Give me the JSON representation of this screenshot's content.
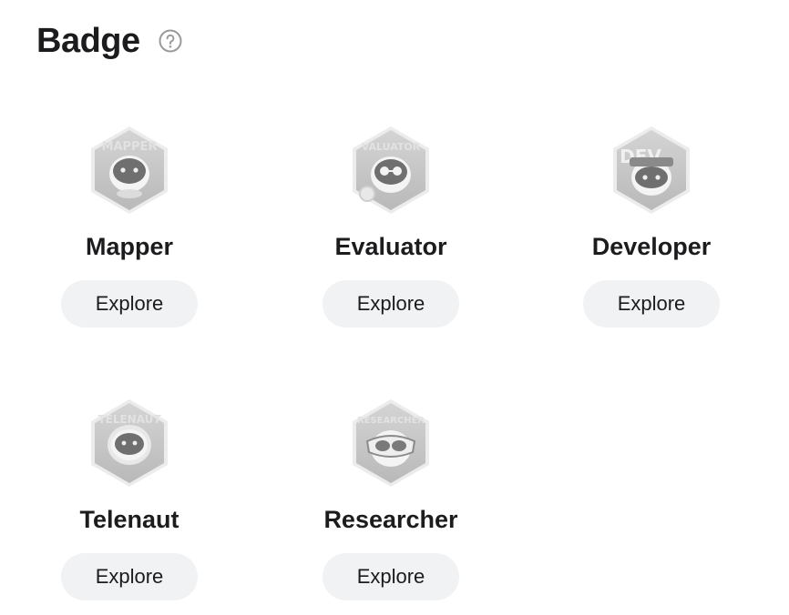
{
  "header": {
    "title": "Badge",
    "help_icon": "question-circle-icon"
  },
  "badges": [
    {
      "name": "Mapper",
      "button": "Explore",
      "icon": "mapper-badge-icon"
    },
    {
      "name": "Evaluator",
      "button": "Explore",
      "icon": "evaluator-badge-icon"
    },
    {
      "name": "Developer",
      "button": "Explore",
      "icon": "developer-badge-icon"
    },
    {
      "name": "Telenaut",
      "button": "Explore",
      "icon": "telenaut-badge-icon"
    },
    {
      "name": "Researcher",
      "button": "Explore",
      "icon": "researcher-badge-icon"
    }
  ]
}
